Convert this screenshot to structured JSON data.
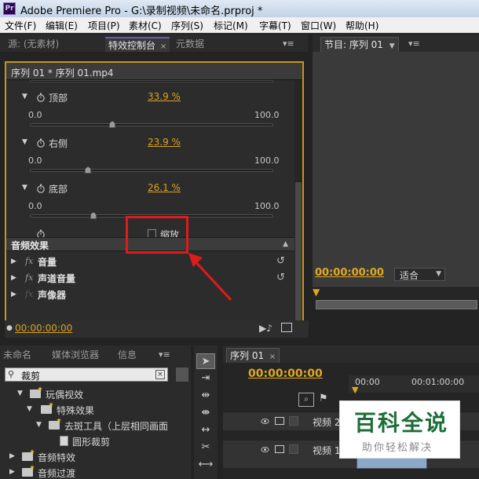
{
  "window": {
    "title": "Adobe Premiere Pro - G:\\录制视频\\未命名.prproj *",
    "logo": "Pr"
  },
  "menu": [
    "文件(F)",
    "编辑(E)",
    "项目(P)",
    "素材(C)",
    "序列(S)",
    "标记(M)",
    "字幕(T)",
    "窗口(W)",
    "帮助(H)"
  ],
  "source_tabs": {
    "source": "源: (无素材)",
    "effect_controls": "特效控制台",
    "metadata": "元数据",
    "close_glyph": "×",
    "menu_glyph": "▾≡"
  },
  "effect_controls": {
    "clip_label": "序列 01 * 序列 01.mp4",
    "properties": [
      {
        "name": "顶部",
        "value": "33.9 %",
        "min": "0.0",
        "max": "100.0",
        "fraction": 0.339
      },
      {
        "name": "右侧",
        "value": "23.9 %",
        "min": "0.0",
        "max": "100.0",
        "fraction": 0.239
      },
      {
        "name": "底部",
        "value": "26.1 %",
        "min": "0.0",
        "max": "100.0",
        "fraction": 0.261
      }
    ],
    "zoom_checkbox": {
      "label": "缩放",
      "checked": false
    },
    "audio_effects_header": "音频效果",
    "audio_effects": [
      {
        "fx": "fx",
        "name": "音量",
        "reset": "↺"
      },
      {
        "fx": "fx",
        "name": "声道音量",
        "reset": "↺"
      },
      {
        "fx": "fx",
        "name": "声像器",
        "reset": ""
      }
    ],
    "footer_time": "00:00:00:00"
  },
  "program_monitor": {
    "tab": "节目: 序列 01",
    "menu_glyph": "▾≡",
    "timecode": "00:00:00:00",
    "fit": "适合"
  },
  "project_panel": {
    "tabs": {
      "project": "未命名",
      "media_browser": "媒体浏览器",
      "info": "信息"
    },
    "search_value": "裁剪",
    "tree": [
      {
        "label": "玩偶视效",
        "type": "folder",
        "indent": 0,
        "expanded": true
      },
      {
        "label": "特殊效果",
        "type": "folder",
        "indent": 1,
        "expanded": true
      },
      {
        "label": "去斑工具（上层相同画面",
        "type": "folder",
        "indent": 2,
        "expanded": true
      },
      {
        "label": "圆形裁剪",
        "type": "file",
        "indent": 3,
        "expanded": false
      },
      {
        "label": "音频特效",
        "type": "folder",
        "indent": 0,
        "expanded": false
      },
      {
        "label": "音频过渡",
        "type": "folder",
        "indent": 0,
        "expanded": false
      }
    ]
  },
  "timeline": {
    "tab": "序列 01",
    "close_glyph": "×",
    "timecode": "00:00:00:00",
    "ruler": [
      "00:00",
      "00:01:00:00"
    ],
    "tracks": [
      "视频 2",
      "视频 1"
    ]
  },
  "watermark": {
    "title": "百科全说",
    "subtitle": "助你轻松解决"
  },
  "colors": {
    "accent_gold": "#d9a21f",
    "highlight_red": "#e01b1b",
    "panel_border": "#c89618"
  }
}
